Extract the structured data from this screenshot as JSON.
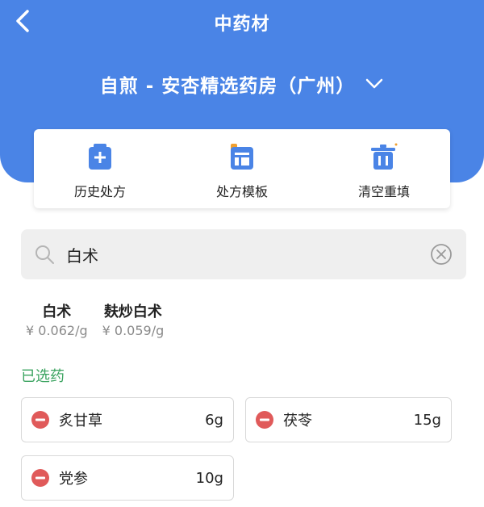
{
  "header": {
    "title": "中药材",
    "store": "自煎 - 安杏精选药房（广州）",
    "color": "#4a84e6"
  },
  "actions": [
    {
      "label": "历史处方",
      "icon": "prescription-history-icon"
    },
    {
      "label": "处方模板",
      "icon": "prescription-template-icon"
    },
    {
      "label": "清空重填",
      "icon": "clear-refill-icon"
    }
  ],
  "search": {
    "value": "白术",
    "placeholder": ""
  },
  "results": [
    {
      "name": "白术",
      "price": "¥ 0.062/g"
    },
    {
      "name": "麸炒白术",
      "price": "¥ 0.059/g"
    }
  ],
  "selected": {
    "title": "已选药",
    "title_color": "#3aa35f",
    "items": [
      {
        "name": "炙甘草",
        "qty": "6g"
      },
      {
        "name": "茯苓",
        "qty": "15g"
      },
      {
        "name": "党参",
        "qty": "10g"
      }
    ]
  }
}
